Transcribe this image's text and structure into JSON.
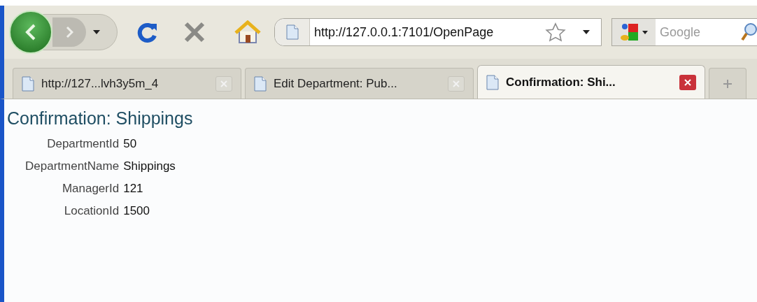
{
  "toolbar": {
    "address": "http://127.0.0.1:7101/OpenPage",
    "search": {
      "placeholder": "Google"
    }
  },
  "tabs": [
    {
      "label": "http://127...lvh3y5m_4",
      "selected": false
    },
    {
      "label": "Edit Department: Pub...",
      "selected": false
    },
    {
      "label": "Confirmation: Shi...",
      "selected": true
    }
  ],
  "page": {
    "heading": "Confirmation: Shippings",
    "fields": [
      {
        "label": "DepartmentId",
        "value": "50"
      },
      {
        "label": "DepartmentName",
        "value": "Shippings"
      },
      {
        "label": "ManagerId",
        "value": "121"
      },
      {
        "label": "LocationId",
        "value": "1500"
      }
    ]
  }
}
